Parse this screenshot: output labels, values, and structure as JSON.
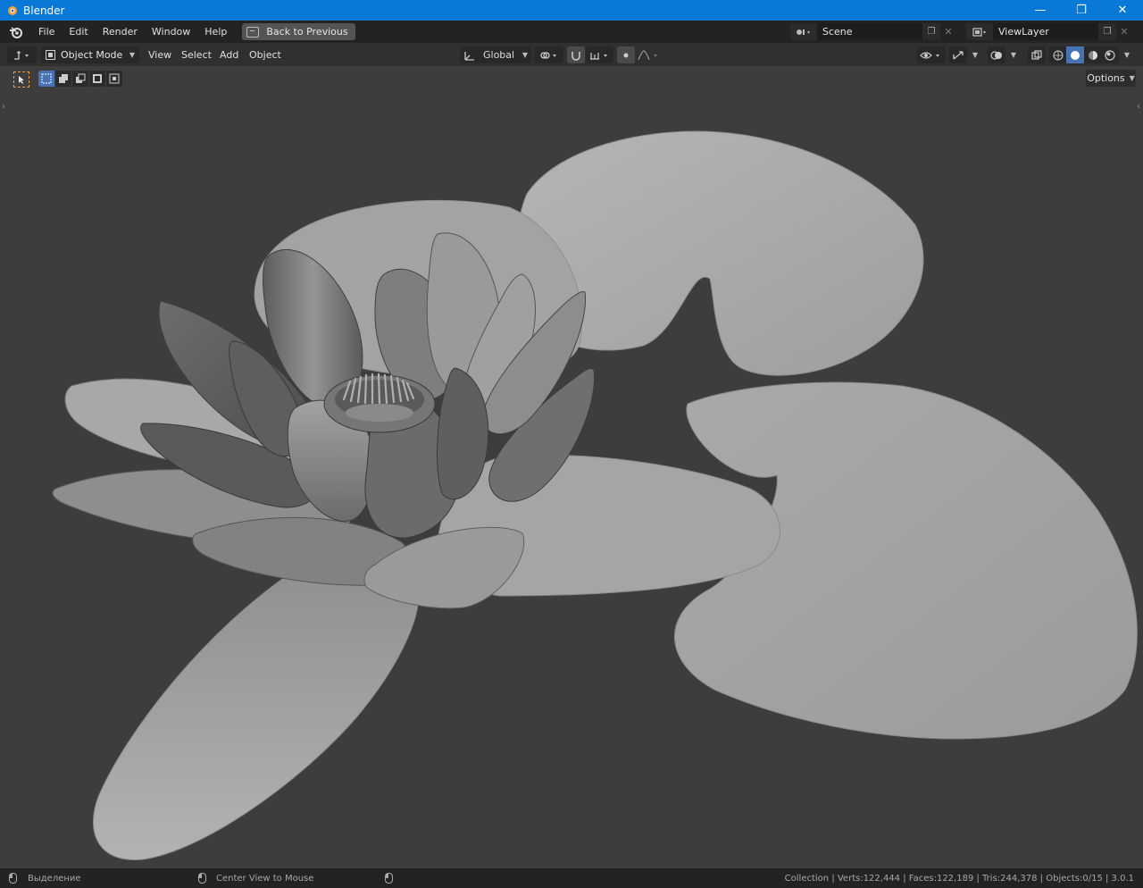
{
  "window": {
    "title": "Blender",
    "minimize": "—",
    "maximize": "❐",
    "close": "✕"
  },
  "menubar": {
    "items": [
      "File",
      "Edit",
      "Render",
      "Window",
      "Help"
    ],
    "back_button": "Back to Previous",
    "scene": "Scene",
    "view_layer": "ViewLayer"
  },
  "header": {
    "mode": "Object Mode",
    "menus": [
      "View",
      "Select",
      "Add",
      "Object"
    ],
    "transform_orientation": "Global"
  },
  "toolrow": {
    "options": "Options"
  },
  "statusbar": {
    "left_action": "Выделение",
    "middle_action": "Center View to Mouse",
    "stats": "Collection | Verts:122,444 | Faces:122,189 | Tris:244,378 | Objects:0/15 | 3.0.1"
  },
  "colors": {
    "titlebar": "#0a78d7",
    "accent_select": "#4772b3"
  }
}
